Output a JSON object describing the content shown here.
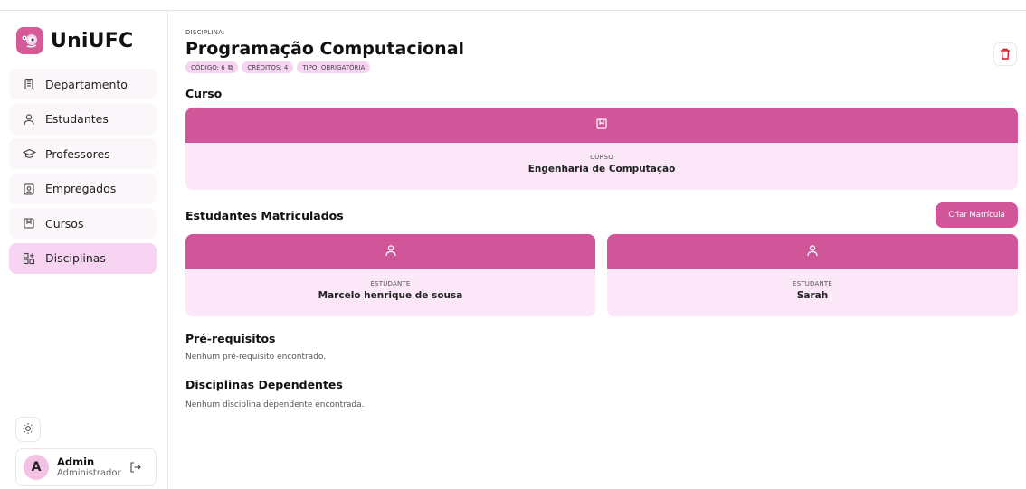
{
  "brand": {
    "name": "UniUFC"
  },
  "sidebar": {
    "items": [
      {
        "label": "Departamento",
        "icon": "building-icon",
        "active": false
      },
      {
        "label": "Estudantes",
        "icon": "user-icon",
        "active": false
      },
      {
        "label": "Professores",
        "icon": "graduation-cap-icon",
        "active": false
      },
      {
        "label": "Empregados",
        "icon": "badge-id-icon",
        "active": false
      },
      {
        "label": "Cursos",
        "icon": "book-icon",
        "active": false
      },
      {
        "label": "Disciplinas",
        "icon": "grid-plus-icon",
        "active": true
      }
    ],
    "theme_icon": "sun-icon"
  },
  "user": {
    "initial": "A",
    "name": "Admin",
    "role": "Administrador",
    "logout_icon": "logout-icon"
  },
  "page": {
    "label": "DISCIPLINA:",
    "title": "Programação Computacional",
    "badges": {
      "codigo": "CÓDIGO: 6",
      "creditos": "CRÉDITOS: 4",
      "tipo": "TIPO: OBRIGATÓRIA"
    },
    "delete_icon": "trash-icon"
  },
  "curso": {
    "heading": "Curso",
    "caption": "CURSO",
    "value": "Engenharia de Computação"
  },
  "estudantes": {
    "heading": "Estudantes Matriculados",
    "create_label": "Criar Matrícula",
    "cards": [
      {
        "caption": "ESTUDANTE",
        "value": "Marcelo henrique de sousa"
      },
      {
        "caption": "ESTUDANTE",
        "value": "Sarah"
      }
    ]
  },
  "prereq": {
    "heading": "Pré-requisitos",
    "empty": "Nenhum pré-requisito encontrado."
  },
  "dependentes": {
    "heading": "Disciplinas Dependentes",
    "empty": "Nenhum disciplina dependente encontrada."
  },
  "colors": {
    "accent": "#d15699",
    "accent_light": "#fbe7f8",
    "active_nav": "#f6d4f2"
  }
}
